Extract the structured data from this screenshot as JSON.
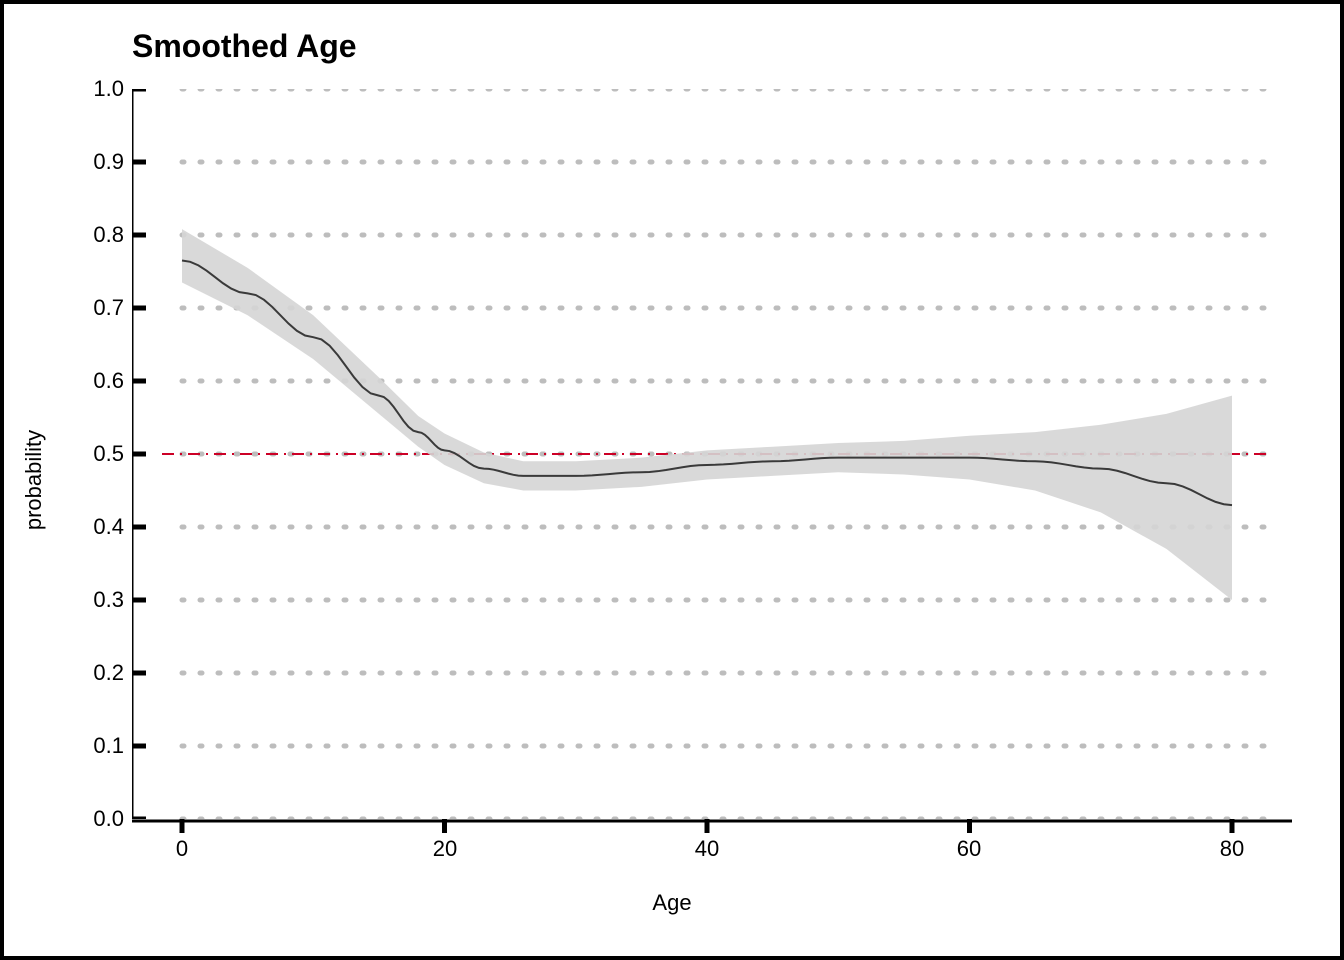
{
  "chart_data": {
    "type": "line",
    "title": "Smoothed Age",
    "xlabel": "Age",
    "ylabel": "probability",
    "xlim": [
      0,
      80
    ],
    "ylim": [
      0.0,
      1.0
    ],
    "x_ticks": [
      0,
      20,
      40,
      60,
      80
    ],
    "y_ticks": [
      0.0,
      0.1,
      0.2,
      0.3,
      0.4,
      0.5,
      0.6,
      0.7,
      0.8,
      0.9,
      1.0
    ],
    "hline": {
      "y": 0.5,
      "style": "dash-dot",
      "color": "red"
    },
    "series": [
      {
        "name": "probability",
        "x": [
          0,
          5,
          10,
          15,
          18,
          20,
          23,
          26,
          30,
          35,
          40,
          45,
          50,
          55,
          60,
          65,
          70,
          75,
          80
        ],
        "values": [
          0.765,
          0.72,
          0.66,
          0.58,
          0.53,
          0.505,
          0.48,
          0.47,
          0.47,
          0.475,
          0.485,
          0.49,
          0.495,
          0.495,
          0.495,
          0.49,
          0.48,
          0.46,
          0.43
        ],
        "ci_low": [
          0.735,
          0.69,
          0.63,
          0.555,
          0.51,
          0.485,
          0.46,
          0.45,
          0.45,
          0.455,
          0.465,
          0.47,
          0.475,
          0.472,
          0.465,
          0.45,
          0.42,
          0.37,
          0.3
        ],
        "ci_high": [
          0.808,
          0.755,
          0.69,
          0.605,
          0.552,
          0.528,
          0.502,
          0.49,
          0.49,
          0.495,
          0.505,
          0.51,
          0.515,
          0.518,
          0.525,
          0.53,
          0.54,
          0.555,
          0.58
        ]
      }
    ]
  },
  "labels": {
    "title": "Smoothed Age",
    "xlabel": "Age",
    "ylabel": "probability",
    "y_ticks_fmt": [
      "0.0",
      "0.1",
      "0.2",
      "0.3",
      "0.4",
      "0.5",
      "0.6",
      "0.7",
      "0.8",
      "0.9",
      "1.0"
    ],
    "x_ticks_fmt": [
      "0",
      "20",
      "40",
      "60",
      "80"
    ]
  },
  "colors": {
    "grid": "#bdbdbd",
    "axis": "#000000",
    "line": "#3a3a3a",
    "ribbon": "#d5d5d5",
    "hline": "#cc0026"
  }
}
